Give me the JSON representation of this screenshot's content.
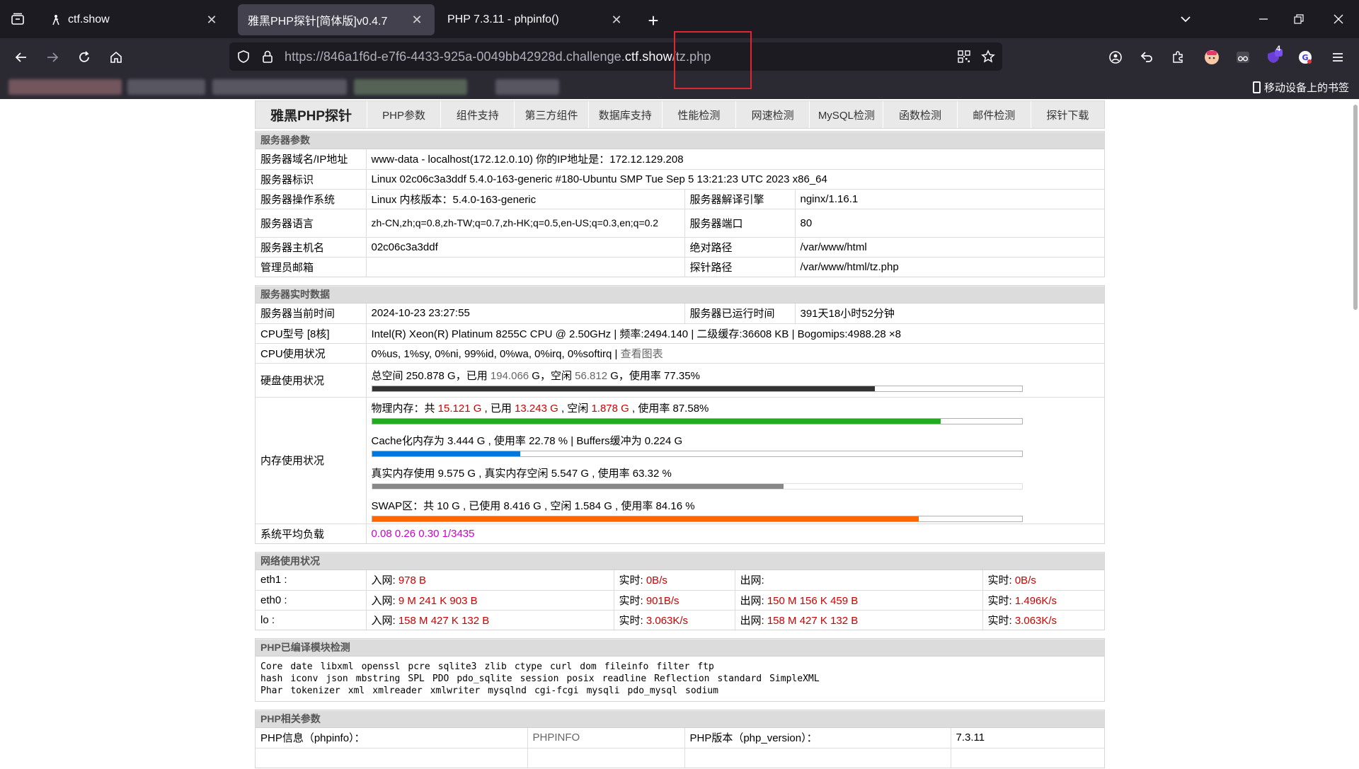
{
  "browser": {
    "tabs": [
      {
        "title": "ctf.show",
        "active": false
      },
      {
        "title": "雅黑PHP探针[简体版]v0.4.7",
        "active": true
      },
      {
        "title": "PHP 7.3.11 - phpinfo()",
        "active": false
      }
    ],
    "url_prefix": "https://846a1f6d-e7f6-4433-925a-0049bb42928d.challenge.",
    "url_host": "ctf.show",
    "url_path": "/tz.php",
    "mobile_bookmarks": "移动设备上的书签",
    "extension_badge": "4"
  },
  "nav": {
    "brand": "雅黑PHP探针",
    "items": [
      "PHP参数",
      "组件支持",
      "第三方组件",
      "数据库支持",
      "性能检测",
      "网速检测",
      "MySQL检测",
      "函数检测",
      "邮件检测",
      "探针下载"
    ]
  },
  "server_params": {
    "title": "服务器参数",
    "domain_label": "服务器域名/IP地址",
    "domain_value": "www-data - localhost(172.12.0.10)  你的IP地址是：172.12.129.208",
    "id_label": "服务器标识",
    "id_value": "Linux 02c06c3a3ddf 5.4.0-163-generic #180-Ubuntu SMP Tue Sep 5 13:21:23 UTC 2023 x86_64",
    "os_label": "服务器操作系统",
    "os_value": "Linux  内核版本：5.4.0-163-generic",
    "engine_label": "服务器解译引擎",
    "engine_value": "nginx/1.16.1",
    "lang_label": "服务器语言",
    "lang_value": "zh-CN,zh;q=0.8,zh-TW;q=0.7,zh-HK;q=0.5,en-US;q=0.3,en;q=0.2",
    "port_label": "服务器端口",
    "port_value": "80",
    "host_label": "服务器主机名",
    "host_value": "02c06c3a3ddf",
    "abspath_label": "绝对路径",
    "abspath_value": "/var/www/html",
    "admin_label": "管理员邮箱",
    "admin_value": "",
    "probe_label": "探针路径",
    "probe_value": "/var/www/html/tz.php"
  },
  "realtime": {
    "title": "服务器实时数据",
    "time_label": "服务器当前时间",
    "time_value": "2024-10-23 23:27:55",
    "uptime_label": "服务器已运行时间",
    "uptime_value": "391天18小时52分钟",
    "cpu_label": "CPU型号 [8核]",
    "cpu_value": "Intel(R) Xeon(R) Platinum 8255C CPU @ 2.50GHz | 频率:2494.140 | 二级缓存:36608 KB | Bogomips:4988.28 ×8",
    "cpuuse_label": "CPU使用状况",
    "cpuuse_value": "0%us, 1%sy, 0%ni, 99%id, 0%wa, 0%irq, 0%softirq",
    "cpuuse_sep": " | ",
    "cpuuse_link": "查看图表",
    "disk_label": "硬盘使用状况",
    "disk_t1": "总空间 250.878 G，已用 ",
    "disk_used": "194.066",
    "disk_t2": " G，空闲 ",
    "disk_free": "56.812",
    "disk_t3": " G，使用率 77.35%",
    "disk_pct": 0.7735,
    "mem_label": "内存使用状况",
    "phys_t1": "物理内存：共 ",
    "phys_total": "15.121 G",
    "phys_t2": " , 已用 ",
    "phys_used": "13.243 G",
    "phys_t3": " , 空闲 ",
    "phys_free": "1.878 G",
    "phys_t4": " , 使用率 87.58%",
    "phys_pct": 0.8758,
    "cache_text": "Cache化内存为 3.444 G , 使用率 22.78 % | Buffers缓冲为 0.224 G",
    "cache_pct": 0.2278,
    "real_text": "真实内存使用 9.575 G , 真实内存空闲 5.547 G , 使用率 63.32 %",
    "real_pct": 0.6332,
    "swap_text": "SWAP区：共 10 G , 已使用 8.416 G , 空闲 1.584 G , 使用率 84.16 %",
    "swap_pct": 0.8416,
    "load_label": "系统平均负载",
    "load_value": "0.08 0.26 0.30 1/3435",
    "colors": {
      "disk": "#333333",
      "phys": "#22aa22",
      "cache": "#0077dd",
      "real": "#888888",
      "swap": "#ff6600"
    }
  },
  "network": {
    "title": "网络使用状况",
    "in_label": "入网: ",
    "rt_label": "实时: ",
    "out_label": "出网: ",
    "rows": [
      {
        "iface": "eth1 :",
        "in": "978 B",
        "in_rt": "0B/s",
        "out": "",
        "out_rt": "0B/s"
      },
      {
        "iface": "eth0 :",
        "in": "9 M 241 K 903 B",
        "in_rt": "901B/s",
        "out": "150 M 156 K 459 B",
        "out_rt": "1.496K/s"
      },
      {
        "iface": "lo :",
        "in": "158 M 427 K 132 B",
        "in_rt": "3.063K/s",
        "out": "158 M 427 K 132 B",
        "out_rt": "3.063K/s"
      }
    ]
  },
  "modules": {
    "title": "PHP已编译模块检测",
    "line1": [
      "Core",
      "date",
      "libxml",
      "openssl",
      "pcre",
      "sqlite3",
      "zlib",
      "ctype",
      "curl",
      "dom",
      "fileinfo",
      "filter",
      "ftp"
    ],
    "line2": [
      "hash",
      "iconv",
      "json",
      "mbstring",
      "SPL",
      "PDO",
      "pdo_sqlite",
      "session",
      "posix",
      "readline",
      "Reflection",
      "standard",
      "SimpleXML"
    ],
    "line3": [
      "Phar",
      "tokenizer",
      "xml",
      "xmlreader",
      "xmlwriter",
      "mysqlnd",
      "cgi-fcgi",
      "mysqli",
      "pdo_mysql",
      "sodium"
    ]
  },
  "php_params": {
    "title": "PHP相关参数",
    "info_label": "PHP信息（phpinfo）：",
    "info_value": "PHPINFO",
    "ver_label": "PHP版本（php_version）：",
    "ver_value": "7.3.11"
  }
}
